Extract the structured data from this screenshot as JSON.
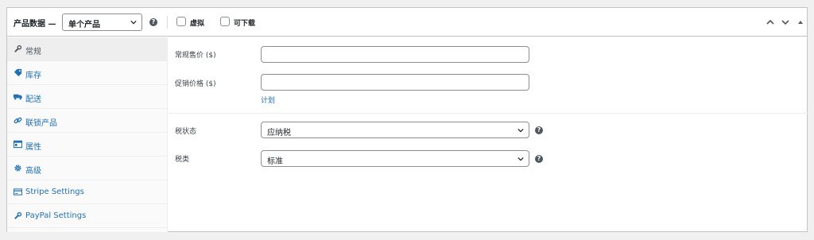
{
  "header": {
    "title": "产品数据 —",
    "product_type": "单个产品",
    "virtual_label": "虚拟",
    "downloadable_label": "可下载"
  },
  "sidebar": {
    "items": [
      {
        "label": "常规",
        "icon": "wrench-icon"
      },
      {
        "label": "库存",
        "icon": "tag-icon"
      },
      {
        "label": "配送",
        "icon": "truck-icon"
      },
      {
        "label": "联锁产品",
        "icon": "link-icon"
      },
      {
        "label": "属性",
        "icon": "table-icon"
      },
      {
        "label": "高级",
        "icon": "gear-icon"
      },
      {
        "label": "Stripe Settings",
        "icon": "card-icon"
      },
      {
        "label": "PayPal Settings",
        "icon": "wrench-icon"
      }
    ]
  },
  "pricing": {
    "regular_price_label": "常规售价 ($)",
    "sale_price_label": "促销价格 ($)",
    "schedule_link": "计划"
  },
  "tax": {
    "status_label": "税状态",
    "status_value": "应纳税",
    "class_label": "税类",
    "class_value": "标准"
  },
  "colors": {
    "link": "#2271b1",
    "border": "#8c8f94",
    "active_tab_bg": "#eeeeee"
  }
}
